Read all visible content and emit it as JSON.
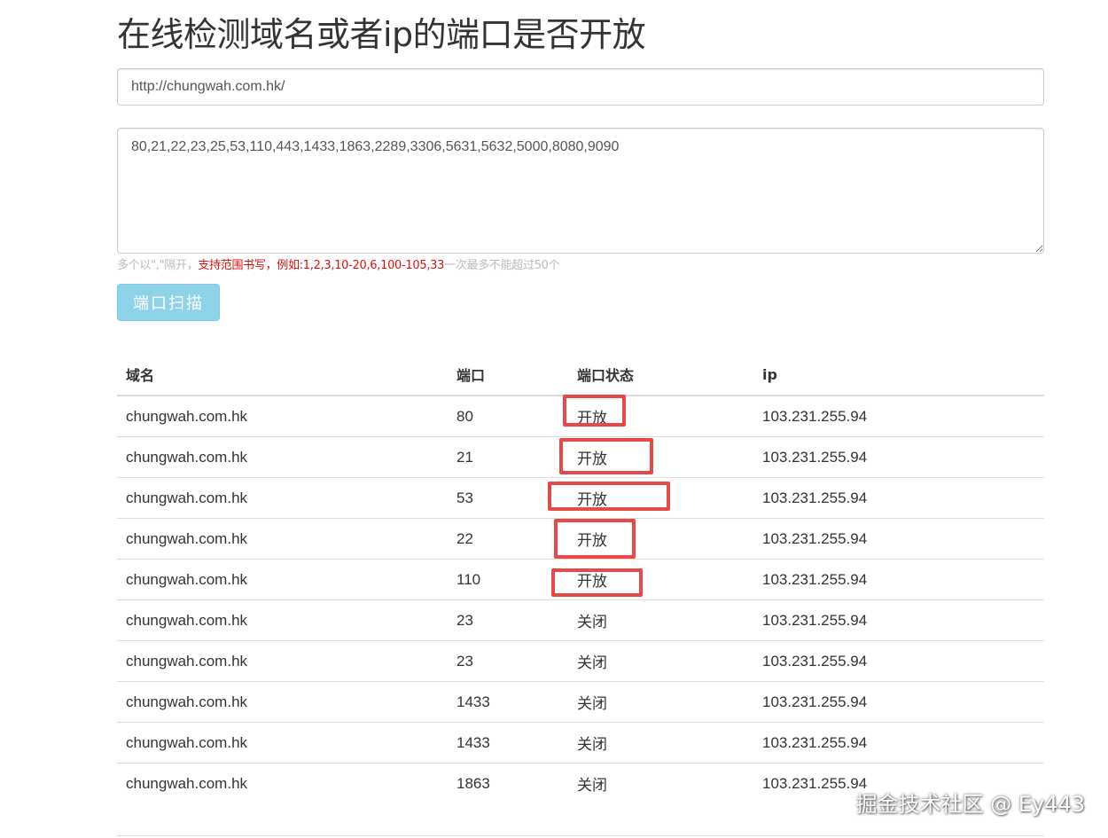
{
  "page": {
    "title": "在线检测域名或者ip的端口是否开放"
  },
  "form": {
    "url_value": "http://chungwah.com.hk/",
    "ports_value": "80,21,22,23,25,53,110,443,1433,1863,2289,3306,5631,5632,5000,8080,9090",
    "help_gray_1": "多个以\",\"隔开，",
    "help_red": "支持范围书写，例如:1,2,3,10-20,6,100-105,33",
    "help_gray_2": "一次最多不能超过50个",
    "scan_label": "端口扫描",
    "scan_color": "#8fd3ea"
  },
  "table": {
    "headers": [
      "域名",
      "端口",
      "端口状态",
      "ip"
    ],
    "rows": [
      {
        "domain": "chungwah.com.hk",
        "port": "80",
        "status": "开放",
        "open": true,
        "ip": "103.231.255.94"
      },
      {
        "domain": "chungwah.com.hk",
        "port": "21",
        "status": "开放",
        "open": true,
        "ip": "103.231.255.94"
      },
      {
        "domain": "chungwah.com.hk",
        "port": "53",
        "status": "开放",
        "open": true,
        "ip": "103.231.255.94"
      },
      {
        "domain": "chungwah.com.hk",
        "port": "22",
        "status": "开放",
        "open": true,
        "ip": "103.231.255.94"
      },
      {
        "domain": "chungwah.com.hk",
        "port": "110",
        "status": "开放",
        "open": true,
        "ip": "103.231.255.94"
      },
      {
        "domain": "chungwah.com.hk",
        "port": "23",
        "status": "关闭",
        "open": false,
        "ip": "103.231.255.94"
      },
      {
        "domain": "chungwah.com.hk",
        "port": "23",
        "status": "关闭",
        "open": false,
        "ip": "103.231.255.94"
      },
      {
        "domain": "chungwah.com.hk",
        "port": "1433",
        "status": "关闭",
        "open": false,
        "ip": "103.231.255.94"
      },
      {
        "domain": "chungwah.com.hk",
        "port": "1433",
        "status": "关闭",
        "open": false,
        "ip": "103.231.255.94"
      },
      {
        "domain": "chungwah.com.hk",
        "port": "1863",
        "status": "关闭",
        "open": false,
        "ip": "103.231.255.94"
      }
    ],
    "open_color": "#e01010",
    "annotation_color": "#e84848"
  },
  "watermark": {
    "text": "掘金技术社区 @ Ey443"
  }
}
